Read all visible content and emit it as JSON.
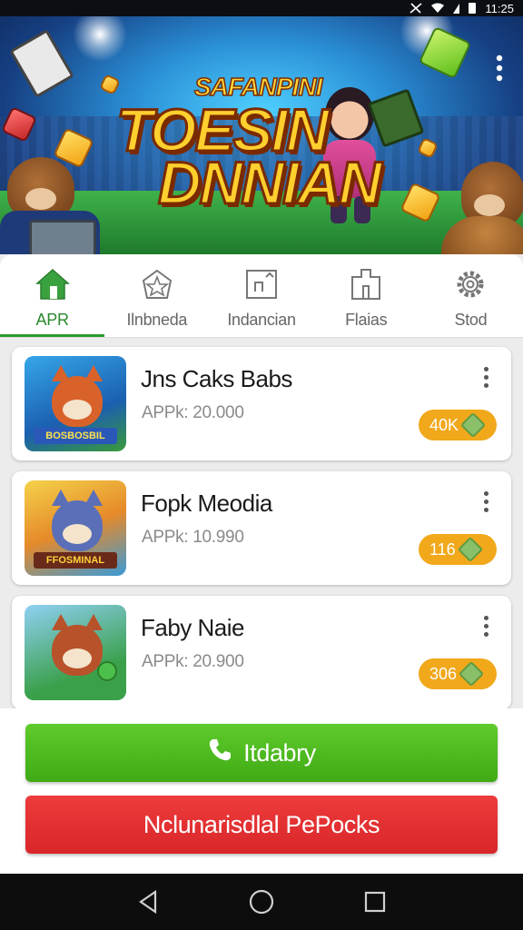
{
  "status_bar": {
    "time": "11:25"
  },
  "hero": {
    "subtitle": "SAFANPINI",
    "title_line1": "TOESIN",
    "title_line2": "DNNIAN"
  },
  "tabs": [
    {
      "label": "APR",
      "icon": "home-icon",
      "active": true
    },
    {
      "label": "Ilnbneda",
      "icon": "star-badge-icon",
      "active": false
    },
    {
      "label": "Indancian",
      "icon": "puzzle-icon",
      "active": false
    },
    {
      "label": "Flaias",
      "icon": "building-icon",
      "active": false
    },
    {
      "label": "Stod",
      "icon": "gear-icon",
      "active": false
    }
  ],
  "apps": [
    {
      "name": "Jns Caks Babs",
      "price": "APPk: 20.000",
      "badge": "40K",
      "thumb_label": "BOSBOSBIL"
    },
    {
      "name": "Fopk Meodia",
      "price": "APPk: 10.990",
      "badge": "116",
      "thumb_label": "FFOSMINAL"
    },
    {
      "name": "Faby Naie",
      "price": "APPk: 20.900",
      "badge": "306",
      "thumb_label": ""
    }
  ],
  "actions": {
    "primary_label": "Itdabry",
    "secondary_label": "Nclunarisdlal PePocks"
  },
  "colors": {
    "accent_green": "#3faa14",
    "danger_red": "#d8262a",
    "badge_orange": "#f1a81b",
    "tab_active": "#2b9a32"
  }
}
